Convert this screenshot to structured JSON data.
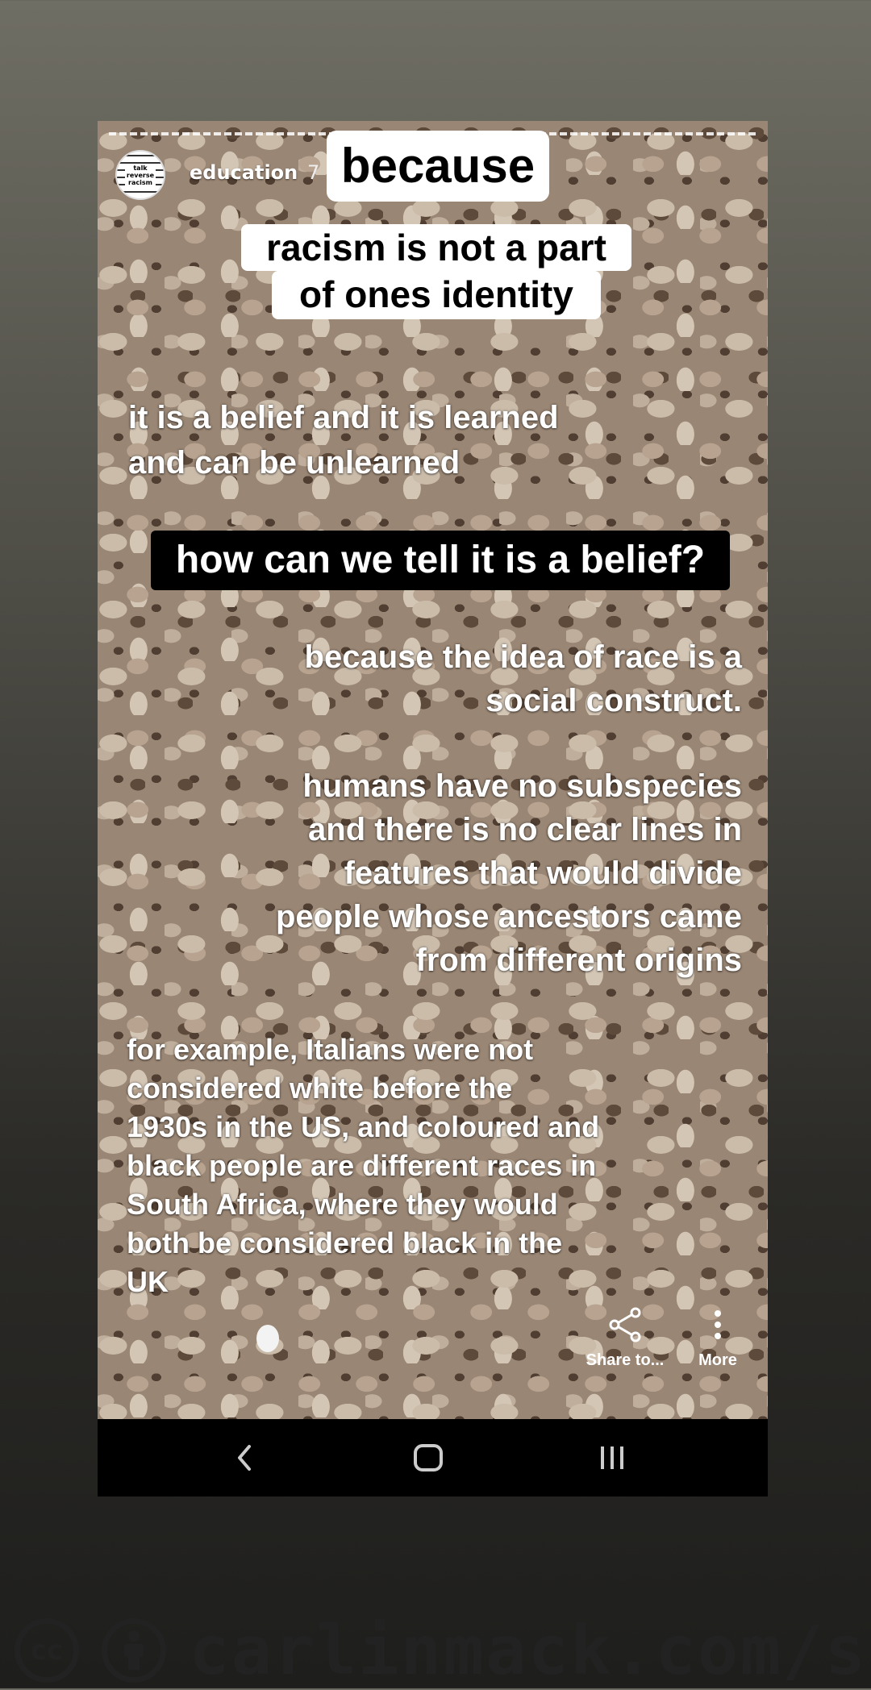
{
  "story": {
    "username": "education",
    "time": "7",
    "avatar_text": "talk\nreverse\nracism",
    "stickers": {
      "because": "because",
      "racism_line1": "racism is not a part",
      "racism_line2": "of ones identity",
      "question": "how can we tell it is a belief?"
    },
    "texts": {
      "belief_line1": "it is a belief and it is learned",
      "belief_line2": "and can be unlearned",
      "construct_line1": "because the idea of race is a",
      "construct_line2": "social construct.",
      "subspecies_line1": "humans have no subspecies",
      "subspecies_line2": "and there is no clear lines in",
      "subspecies_line3": "features that would divide",
      "subspecies_line4": "people whose ancestors came",
      "subspecies_line5": "from different origins",
      "example_line1": "for example, Italians were not",
      "example_line2": "considered white before the",
      "example_line3": "1930s in the US, and coloured and",
      "example_line4": "black people are different races in",
      "example_line5": "South Africa, where they would",
      "example_line6": "both be considered black in the",
      "example_line7": "UK"
    },
    "actions": {
      "share_label": "Share to...",
      "more_label": "More"
    }
  },
  "watermark": {
    "text": "carlinmack.com/s"
  },
  "icons": [
    "share-icon",
    "more-vertical-icon",
    "back-icon",
    "home-icon",
    "recents-icon",
    "cc-icon",
    "attribution-icon"
  ]
}
